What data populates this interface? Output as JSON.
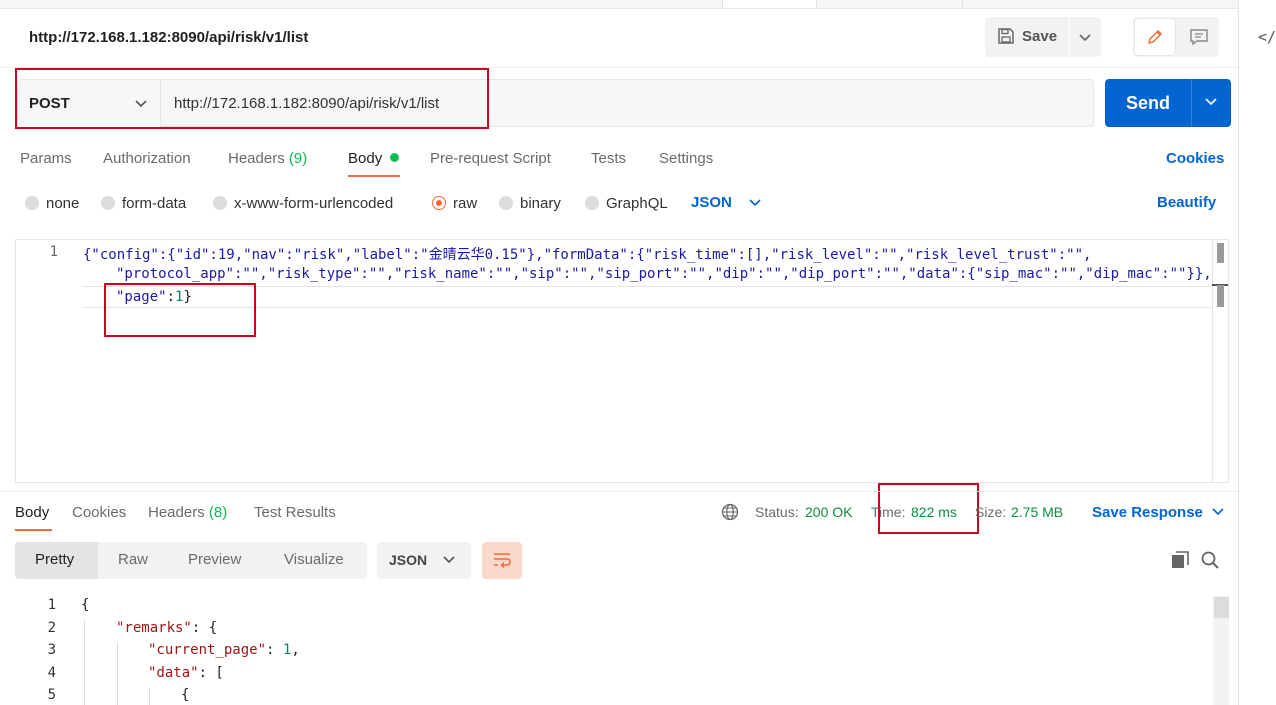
{
  "request": {
    "title": "http://172.168.1.182:8090/api/risk/v1/list",
    "method": "POST",
    "url": "http://172.168.1.182:8090/api/risk/v1/list",
    "save_label": "Save",
    "send_label": "Send"
  },
  "sidebar": {
    "code_toggle": "</>"
  },
  "tabs": {
    "params": "Params",
    "authorization": "Authorization",
    "headers": "Headers",
    "headers_count": "(9)",
    "body": "Body",
    "prerequest": "Pre-request Script",
    "tests": "Tests",
    "settings": "Settings",
    "cookies": "Cookies"
  },
  "body_options": {
    "none": "none",
    "form_data": "form-data",
    "urlencoded": "x-www-form-urlencoded",
    "raw": "raw",
    "binary": "binary",
    "graphql": "GraphQL",
    "language": "JSON",
    "beautify": "Beautify",
    "selected": "raw"
  },
  "editor": {
    "line_number": "1",
    "line1": "{\"config\":{\"id\":19,\"nav\":\"risk\",\"label\":\"金晴云华0.15\"},\"formData\":{\"risk_time\":[],\"risk_level\":\"\",\"risk_level_trust\":\"\",",
    "line2": "\"protocol_app\":\"\",\"risk_type\":\"\",\"risk_name\":\"\",\"sip\":\"\",\"sip_port\":\"\",\"dip\":\"\",\"dip_port\":\"\",\"data\":{\"sip_mac\":\"\",\"dip_mac\":\"\"}},",
    "line3_key": "\"page\"",
    "line3_colon": ":",
    "line3_num": "1",
    "line3_end": "}"
  },
  "response": {
    "tabs": {
      "body": "Body",
      "cookies": "Cookies",
      "headers": "Headers",
      "headers_count": "(8)",
      "test_results": "Test Results"
    },
    "status_label": "Status:",
    "status_value": "200 OK",
    "time_label": "Time:",
    "time_value": "822 ms",
    "size_label": "Size:",
    "size_value": "2.75 MB",
    "save_response": "Save Response",
    "views": {
      "pretty": "Pretty",
      "raw": "Raw",
      "preview": "Preview",
      "visualize": "Visualize"
    },
    "language": "JSON",
    "lines": [
      {
        "n": "1",
        "text": "{"
      },
      {
        "n": "2",
        "key": "\"remarks\"",
        "rest": ": {"
      },
      {
        "n": "3",
        "key": "\"current_page\"",
        "colon": ": ",
        "num": "1",
        "rest": ","
      },
      {
        "n": "4",
        "key": "\"data\"",
        "rest": ": ["
      },
      {
        "n": "5",
        "text": "{"
      }
    ]
  },
  "colors": {
    "send_blue": "#0265d2",
    "accent_orange": "#f26b3a",
    "success_green": "#0cbb52",
    "highlight_red": "#d0021b"
  }
}
